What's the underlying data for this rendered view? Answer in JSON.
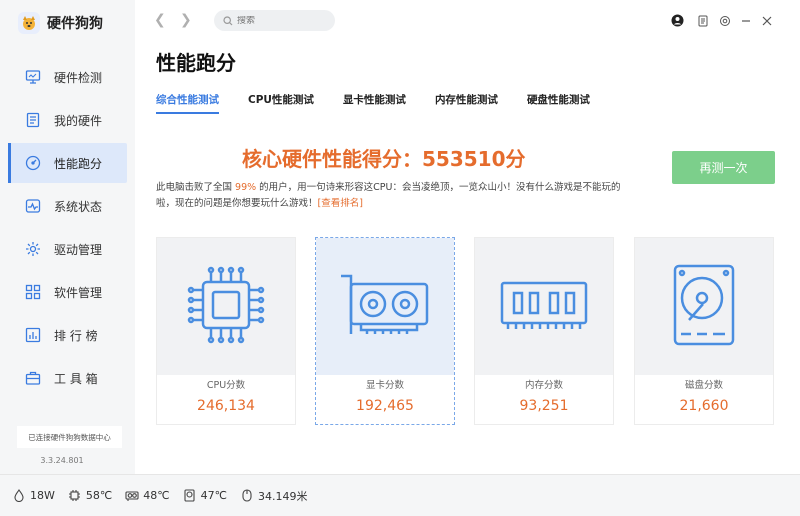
{
  "app": {
    "title": "硬件狗狗",
    "version": "3.3.24.801",
    "connection_status": "已连接硬件狗狗数据中心"
  },
  "sidebar": {
    "items": [
      {
        "label": "硬件检测",
        "icon": "monitor-icon"
      },
      {
        "label": "我的硬件",
        "icon": "document-icon"
      },
      {
        "label": "性能跑分",
        "icon": "speedometer-icon",
        "active": true
      },
      {
        "label": "系统状态",
        "icon": "pulse-icon"
      },
      {
        "label": "驱动管理",
        "icon": "gear-icon"
      },
      {
        "label": "软件管理",
        "icon": "grid-icon"
      },
      {
        "label": "排 行 榜",
        "icon": "ranking-icon"
      },
      {
        "label": "工 具 箱",
        "icon": "toolbox-icon"
      }
    ]
  },
  "search": {
    "placeholder": "搜索"
  },
  "page": {
    "title": "性能跑分",
    "tabs": [
      {
        "label": "综合性能测试",
        "active": true
      },
      {
        "label": "CPU性能测试"
      },
      {
        "label": "显卡性能测试"
      },
      {
        "label": "内存性能测试"
      },
      {
        "label": "硬盘性能测试"
      }
    ],
    "score_title": "核心硬件性能得分：553510分",
    "retest_label": "再测一次",
    "desc_prefix": "此电脑击败了全国 ",
    "desc_pct": "99%",
    "desc_body": " 的用户，用一句诗来形容这CPU：会当凌绝顶，一览众山小！没有什么游戏是不能玩的啦，现在的问题是你想要玩什么游戏！",
    "desc_link": "[查看排名]"
  },
  "cards": [
    {
      "label": "CPU分数",
      "value": "246,134",
      "icon": "cpu-icon"
    },
    {
      "label": "显卡分数",
      "value": "192,465",
      "icon": "gpu-icon"
    },
    {
      "label": "内存分数",
      "value": "93,251",
      "icon": "ram-icon"
    },
    {
      "label": "磁盘分数",
      "value": "21,660",
      "icon": "hdd-icon"
    }
  ],
  "footer": {
    "power": "18W",
    "cpu_temp": "58℃",
    "gpu_temp": "48℃",
    "disk_temp": "47℃",
    "mouse_distance": "34.149米"
  },
  "colors": {
    "accent": "#3a7be0",
    "score": "#e56c2d",
    "retest": "#7ccf8b",
    "icon_blue": "#4a8ee0"
  }
}
